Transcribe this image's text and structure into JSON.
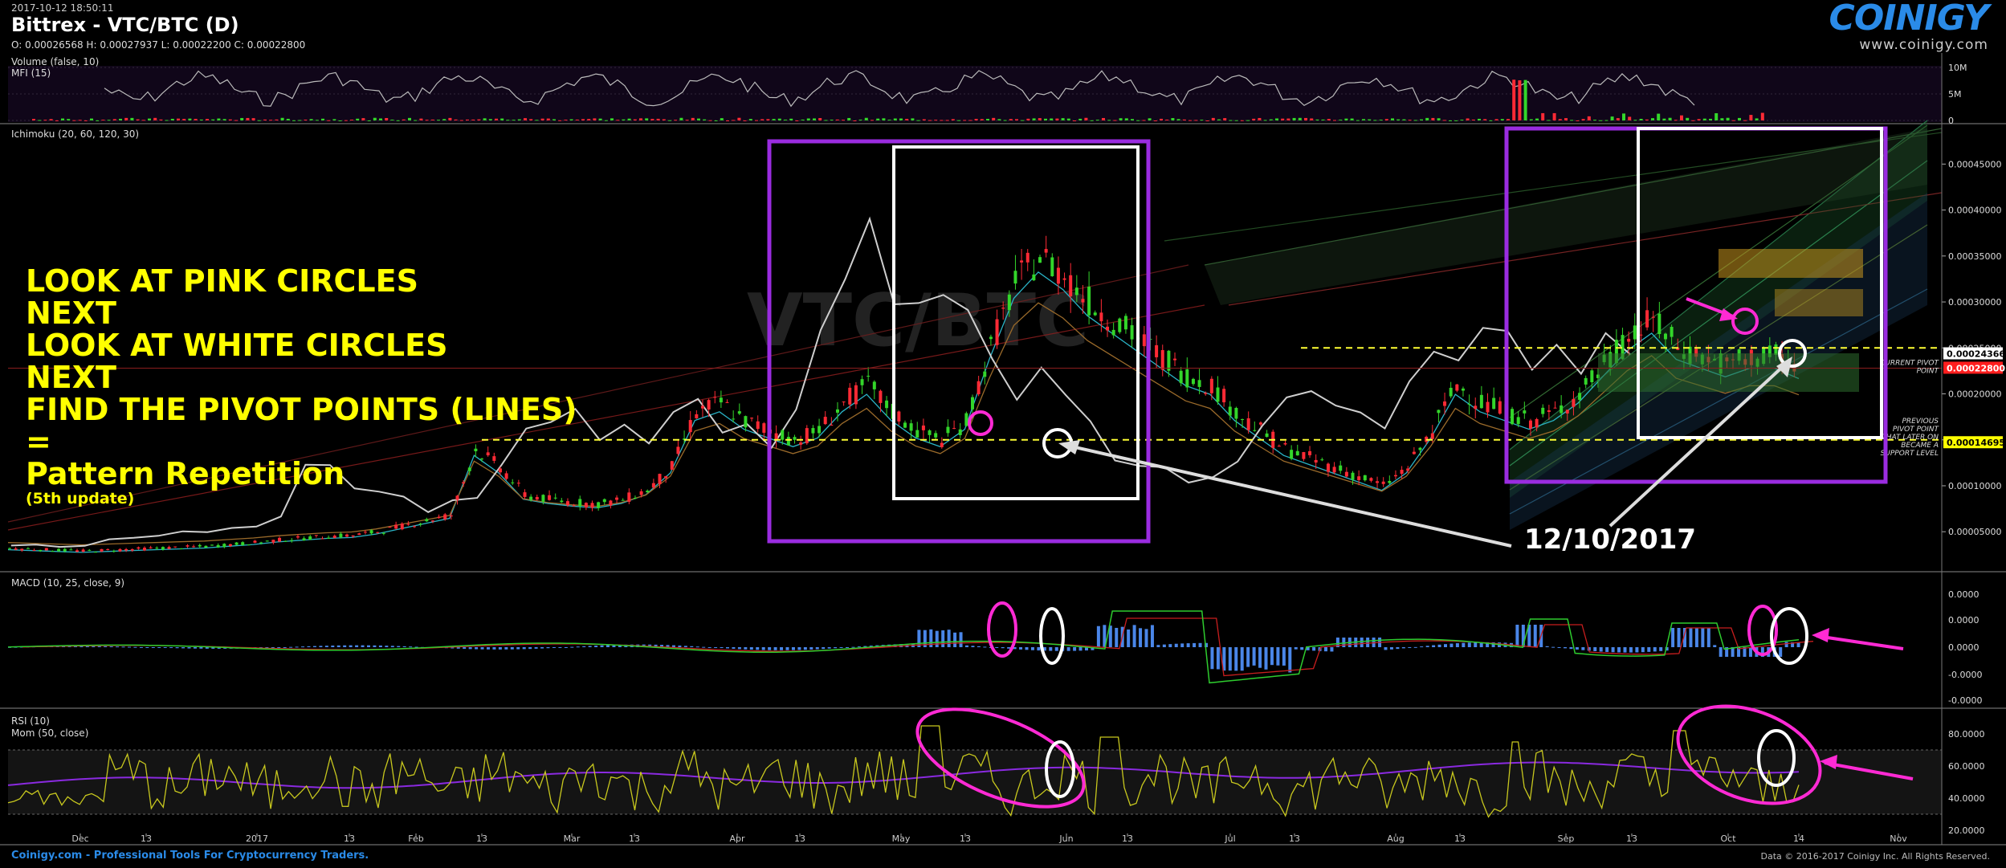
{
  "header": {
    "timestamp": "2017-10-12 18:50:11",
    "title": "Bittrex - VTC/BTC (D)",
    "ohlc": "O: 0.00026568 H: 0.00027937 L: 0.00022200 C: 0.00022800"
  },
  "logo": {
    "name": "COINIGY",
    "url": "www.coinigy.com"
  },
  "watermark": "VTC/BTC",
  "footer": {
    "left": "Coinigy.com - Professional Tools For Cryptocurrency Traders.",
    "right": "Data © 2016-2017 Coinigy Inc. All Rights Reserved."
  },
  "colors": {
    "background": "#000000",
    "annotation_text": "#ffff00",
    "pink_circle": "#ff2ad4",
    "box_purple": "#9a2ce0",
    "box_white": "#ffffff",
    "up_candle": "#33d62a",
    "down_candle": "#ff2a35",
    "pivot_line": "#ffff33",
    "macd_hist": "#4a86e8",
    "logo": "#2a8be8"
  },
  "annotation": {
    "lines": [
      "LOOK AT PINK CIRCLES",
      "NEXT",
      "LOOK AT WHITE CIRCLES",
      "NEXT",
      "FIND THE PIVOT POINTS (LINES)",
      "=",
      "Pattern Repetition"
    ],
    "sub": "(5th update)",
    "date_label": "12/10/2017"
  },
  "chart_data": [
    {
      "type": "bar",
      "title": "Volume (false, 10)",
      "subtitle": "MFI (15)",
      "y_ticks": [
        "10M",
        "5M",
        "0"
      ],
      "ylim": [
        0,
        10000000
      ]
    },
    {
      "type": "line",
      "title": "Ichimoku (20, 60, 120, 30)",
      "y_ticks": [
        "0.00045000",
        "0.00040000",
        "0.00035000",
        "0.00030000",
        "0.00025000",
        "0.00020000",
        "0.00015000",
        "0.00010000",
        "0.00005000"
      ],
      "ylim": [
        1e-05,
        0.00048
      ],
      "price_labels": [
        {
          "value": 0.00024366,
          "label": "0.00024366",
          "note": "CURRENT PIVOT POINT"
        },
        {
          "value": 0.000228,
          "label": "0.00022800",
          "note": ""
        },
        {
          "value": 0.00014695,
          "label": "0.00014695",
          "note": "PREVIOUS PIVOT POINT THAT LATER ON BECAME A SUPPORT LEVEL"
        }
      ],
      "pivot_levels": [
        0.00025,
        0.00015
      ],
      "x_ticks": [
        "Dec",
        "13",
        "2017",
        "13",
        "Feb",
        "13",
        "Mar",
        "13",
        "Apr",
        "13",
        "May",
        "13",
        "Jun",
        "13",
        "Jul",
        "13",
        "Aug",
        "13",
        "Sep",
        "13",
        "Oct",
        "14",
        "Nov"
      ],
      "price_series": [
        3.2e-05,
        3.1e-05,
        3e-05,
        2.9e-05,
        3e-05,
        3.1e-05,
        3.2e-05,
        3.3e-05,
        3.4e-05,
        3.6e-05,
        3.8e-05,
        4.1e-05,
        4.3e-05,
        4.5e-05,
        4.6e-05,
        5e-05,
        5.6e-05,
        6.2e-05,
        6.8e-05,
        0.00014,
        0.00012,
        9e-05,
        8.5e-05,
        8.2e-05,
        8e-05,
        8.5e-05,
        9.5e-05,
        0.00012,
        0.00018,
        0.00019,
        0.00017,
        0.00016,
        0.00015,
        0.00016,
        0.00019,
        0.00021,
        0.00018,
        0.00016,
        0.00015,
        0.00017,
        0.00025,
        0.00032,
        0.00035,
        0.00033,
        0.0003,
        0.00028,
        0.00026,
        0.00024,
        0.00022,
        0.00021,
        0.00018,
        0.00016,
        0.00014,
        0.00013,
        0.00012,
        0.00011,
        0.0001,
        0.00012,
        0.00016,
        0.00021,
        0.00019,
        0.00018,
        0.00017,
        0.00018,
        0.0002,
        0.00023,
        0.00026,
        0.00028,
        0.00025,
        0.00024,
        0.00023,
        0.00024,
        0.00024,
        0.000228
      ]
    },
    {
      "type": "line",
      "title": "MACD (10, 25, close, 9)",
      "y_ticks": [
        "0.0000",
        "0.0000",
        "0.0000",
        "-0.0000",
        "-0.0000"
      ]
    },
    {
      "type": "line",
      "title": "RSI (10)",
      "subtitle": "Mom (50, close)",
      "y_ticks": [
        "80.0000",
        "60.0000",
        "40.0000",
        "20.0000"
      ],
      "ylim": [
        20,
        90
      ]
    }
  ]
}
